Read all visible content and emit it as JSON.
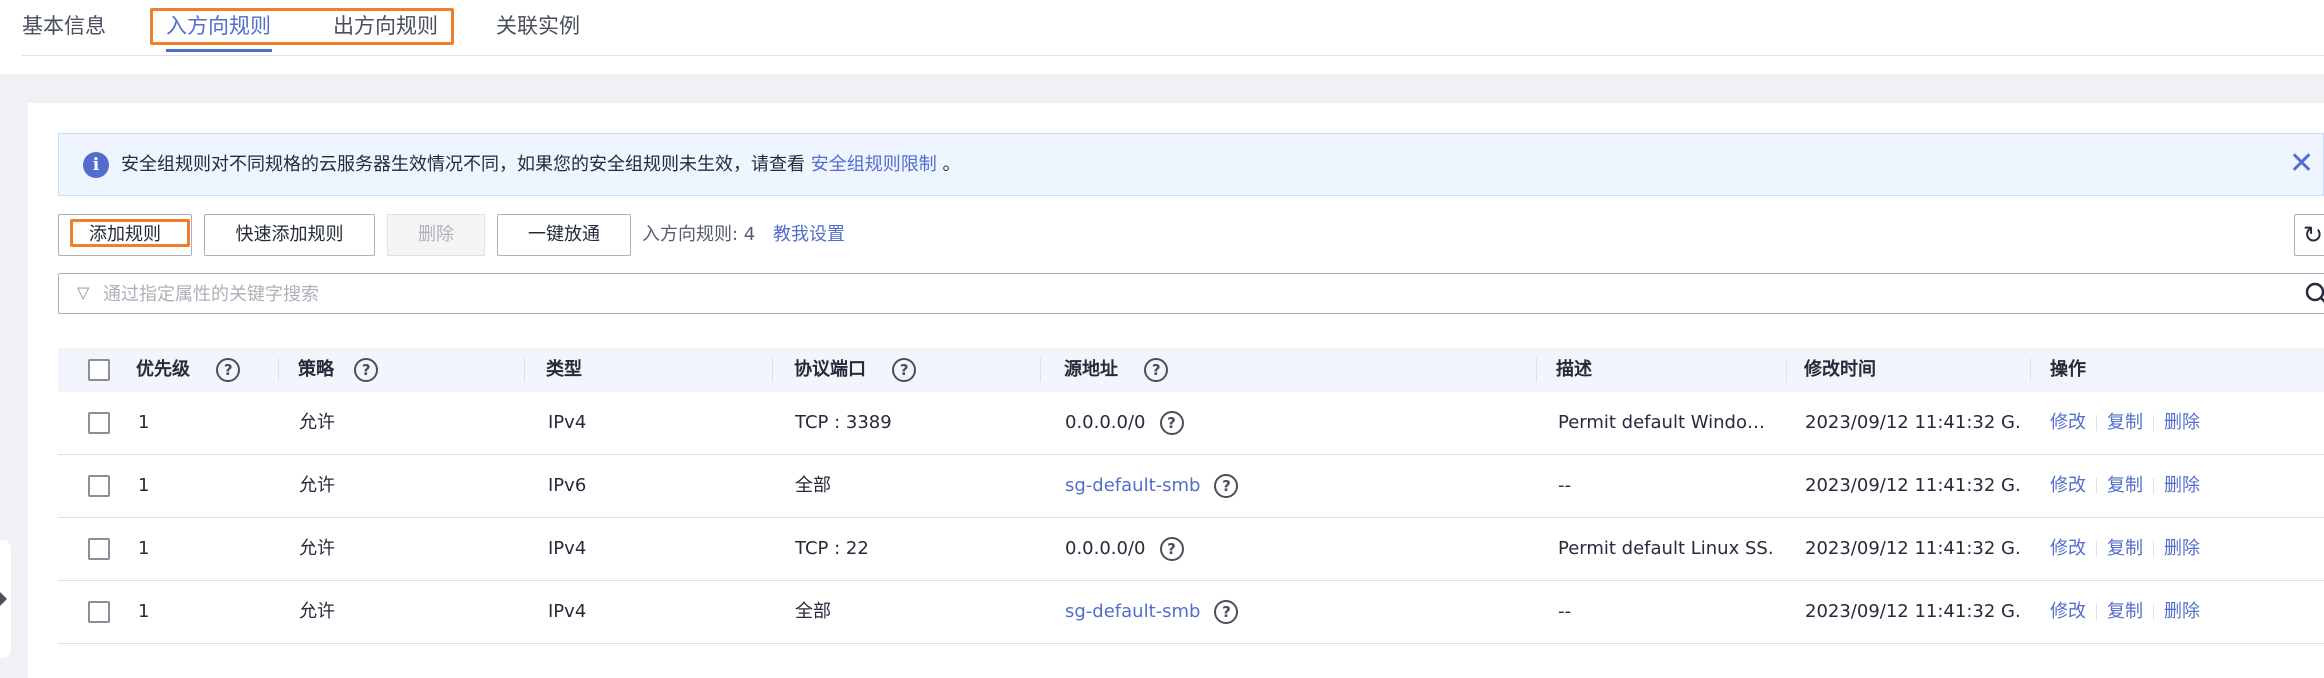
{
  "tabs": [
    {
      "label": "基本信息",
      "active": false
    },
    {
      "label": "入方向规则",
      "active": true
    },
    {
      "label": "出方向规则",
      "active": false
    },
    {
      "label": "关联实例",
      "active": false
    }
  ],
  "alert": {
    "icon": "info-icon",
    "text": "安全组规则对不同规格的云服务器生效情况不同，如果您的安全组规则未生效，请查看",
    "link": "安全组规则限制",
    "suffix": " 。"
  },
  "toolbar": {
    "add_rule": "添加规则",
    "quick_add": "快速添加规则",
    "delete": "删除",
    "one_click": "一键放通",
    "rule_count": "入方向规则: 4",
    "teach": "教我设置"
  },
  "search": {
    "placeholder": "通过指定属性的关键字搜索",
    "value": ""
  },
  "table": {
    "columns": [
      "优先级",
      "策略",
      "类型",
      "协议端口",
      "源地址",
      "描述",
      "修改时间",
      "操作"
    ],
    "rows": [
      {
        "priority": "1",
        "policy": "允许",
        "type": "IPv4",
        "port": "TCP : 3389",
        "source": "0.0.0.0/0",
        "source_is_link": false,
        "desc": "Permit default Windows ...",
        "time": "2023/09/12 11:41:32 G..."
      },
      {
        "priority": "1",
        "policy": "允许",
        "type": "IPv6",
        "port": "全部",
        "source": "sg-default-smb",
        "source_is_link": true,
        "desc": "--",
        "time": "2023/09/12 11:41:32 G..."
      },
      {
        "priority": "1",
        "policy": "允许",
        "type": "IPv4",
        "port": "TCP : 22",
        "source": "0.0.0.0/0",
        "source_is_link": false,
        "desc": "Permit default Linux SS...",
        "time": "2023/09/12 11:41:32 G..."
      },
      {
        "priority": "1",
        "policy": "允许",
        "type": "IPv4",
        "port": "全部",
        "source": "sg-default-smb",
        "source_is_link": true,
        "desc": "--",
        "time": "2023/09/12 11:41:32 G..."
      }
    ],
    "ops": {
      "modify": "修改",
      "copy": "复制",
      "delete": "删除"
    }
  },
  "colors": {
    "accent": "#526ecc",
    "highlight": "#f07f2c"
  }
}
